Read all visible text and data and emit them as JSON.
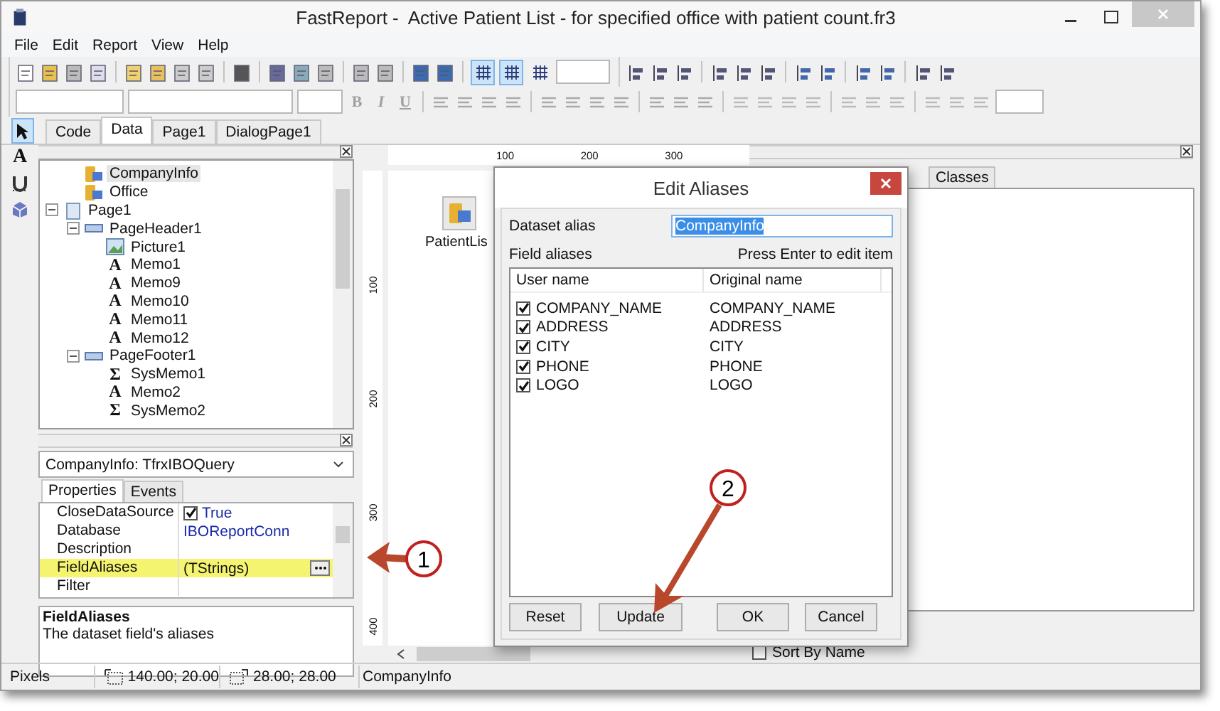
{
  "window": {
    "title": "FastReport -  Active Patient List - for specified office with patient count.fr3"
  },
  "menu": [
    "File",
    "Edit",
    "Report",
    "View",
    "Help"
  ],
  "toolbar": {
    "toggles": [
      {
        "selected": true
      },
      {
        "selected": true
      },
      {
        "selected": false
      }
    ],
    "format_buttons": [
      {
        "label": "B",
        "disabled": true
      },
      {
        "label": "I",
        "disabled": true
      },
      {
        "label": "U",
        "disabled": true
      }
    ]
  },
  "tools": [
    {
      "kind": "pointer",
      "selected": true
    },
    {
      "kind": "text",
      "glyph": "A",
      "selected": false
    },
    {
      "kind": "tool",
      "selected": false
    },
    {
      "kind": "cube",
      "selected": false
    }
  ],
  "tabs": [
    {
      "label": "Code",
      "selected": false
    },
    {
      "label": "Data",
      "selected": true
    },
    {
      "label": "Page1",
      "selected": false
    },
    {
      "label": "DialogPage1",
      "selected": false
    }
  ],
  "tree": {
    "partial_branch": [
      {
        "label": "CompanyInfo",
        "kind": "dataset",
        "selected": true
      },
      {
        "label": "Office",
        "kind": "dataset",
        "selected": false
      }
    ],
    "items": [
      {
        "label": "Page1",
        "kind": "page",
        "selected": false,
        "expanded": true,
        "children": [
          {
            "label": "PageHeader1",
            "kind": "band",
            "selected": false,
            "expanded": true,
            "children": [
              {
                "label": "Picture1",
                "kind": "picture",
                "selected": false
              },
              {
                "label": "Memo1",
                "kind": "memo",
                "glyph": "A",
                "selected": false
              },
              {
                "label": "Memo9",
                "kind": "memo",
                "glyph": "A",
                "selected": false
              },
              {
                "label": "Memo10",
                "kind": "memo",
                "glyph": "A",
                "selected": false
              },
              {
                "label": "Memo11",
                "kind": "memo",
                "glyph": "A",
                "selected": false
              },
              {
                "label": "Memo12",
                "kind": "memo",
                "glyph": "A",
                "selected": false
              }
            ]
          },
          {
            "label": "PageFooter1",
            "kind": "band",
            "selected": false,
            "expanded": true,
            "children": [
              {
                "label": "SysMemo1",
                "kind": "sysmemo",
                "glyph": "Σ",
                "selected": false
              },
              {
                "label": "Memo2",
                "kind": "memo",
                "glyph": "A",
                "selected": false
              },
              {
                "label": "SysMemo2",
                "kind": "sysmemo",
                "glyph": "Σ",
                "selected": false
              }
            ]
          }
        ]
      }
    ]
  },
  "properties": {
    "object": "CompanyInfo: TfrxIBOQuery",
    "tabs": [
      {
        "label": "Properties",
        "selected": true
      },
      {
        "label": "Events",
        "selected": false
      }
    ],
    "rows": [
      {
        "name": "CloseDataSource",
        "value": "True",
        "kind": "checkbox",
        "checked": true,
        "highlighted": false
      },
      {
        "name": "Database",
        "value": "IBOReportConn",
        "kind": "text",
        "highlighted": false
      },
      {
        "name": "Description",
        "kind": "text",
        "highlighted": false
      },
      {
        "name": "FieldAliases",
        "value": "(TStrings)",
        "kind": "editor",
        "highlighted": true
      },
      {
        "name": "Filter",
        "kind": "text",
        "highlighted": false
      }
    ],
    "help_title": "FieldAliases",
    "help_text": "The dataset field's aliases"
  },
  "designer": {
    "ruler_horizontal": [
      "100",
      "200",
      "300"
    ],
    "ruler_vertical": [
      "100",
      "200",
      "300",
      "400"
    ],
    "object_label": "PatientLis"
  },
  "data_panel": {
    "tabs": [
      {
        "label": "Classes",
        "selected": false
      }
    ],
    "sort_by_name": {
      "label": "Sort By Name",
      "checked": false
    }
  },
  "status_bar": {
    "units": "Pixels",
    "position": "140.00; 20.00",
    "size": "28.00; 28.00",
    "object": "CompanyInfo"
  },
  "dialog": {
    "title": "Edit Aliases",
    "dataset_alias_label": "Dataset alias",
    "dataset_alias": "CompanyInfo",
    "text_selected": true,
    "field_aliases_label": "Field aliases",
    "hint": "Press Enter to edit item",
    "columns": [
      "User name",
      "Original name"
    ],
    "rows": [
      {
        "user_name": "COMPANY_NAME",
        "original_name": "COMPANY_NAME",
        "checked": true
      },
      {
        "user_name": "ADDRESS",
        "original_name": "ADDRESS",
        "checked": true
      },
      {
        "user_name": "CITY",
        "original_name": "CITY",
        "checked": true
      },
      {
        "user_name": "PHONE",
        "original_name": "PHONE",
        "checked": true
      },
      {
        "user_name": "LOGO",
        "original_name": "LOGO",
        "checked": true
      }
    ],
    "buttons": [
      "Reset",
      "Update",
      "OK",
      "Cancel"
    ]
  },
  "callouts": [
    {
      "label": "1"
    },
    {
      "label": "2"
    }
  ]
}
